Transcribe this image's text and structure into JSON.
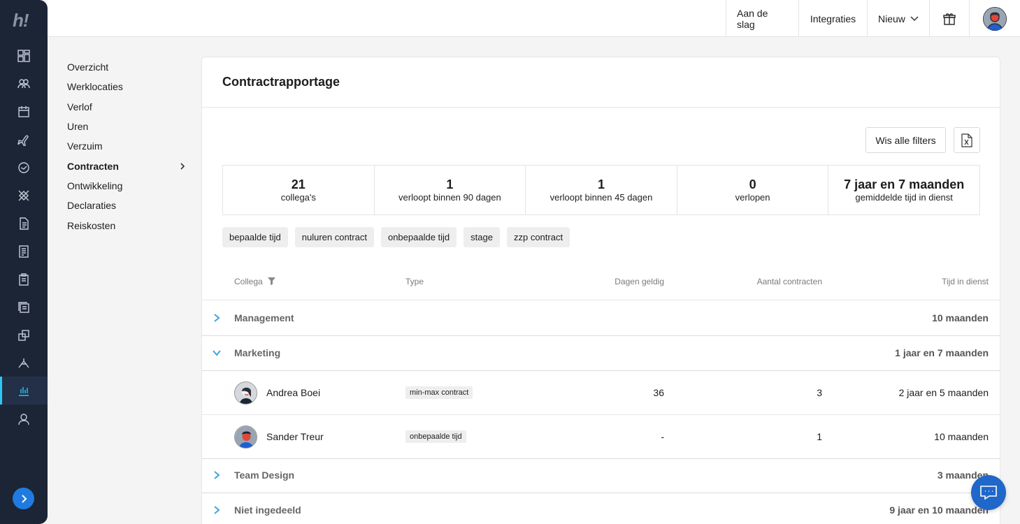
{
  "app": {
    "logo": "h!"
  },
  "topbar": {
    "getting_started": "Aan de slag",
    "integrations": "Integraties",
    "new": "Nieuw"
  },
  "submenu": [
    {
      "label": "Overzicht"
    },
    {
      "label": "Werklocaties"
    },
    {
      "label": "Verlof"
    },
    {
      "label": "Uren"
    },
    {
      "label": "Verzuim"
    },
    {
      "label": "Contracten",
      "active": true
    },
    {
      "label": "Ontwikkeling"
    },
    {
      "label": "Declaraties"
    },
    {
      "label": "Reiskosten"
    }
  ],
  "page": {
    "title": "Contractrapportage",
    "clear_filters": "Wis alle filters"
  },
  "stats": [
    {
      "value": "21",
      "label": "collega's"
    },
    {
      "value": "1",
      "label": "verloopt binnen 90 dagen"
    },
    {
      "value": "1",
      "label": "verloopt binnen 45 dagen"
    },
    {
      "value": "0",
      "label": "verlopen"
    },
    {
      "value": "7 jaar en 7 maanden",
      "label": "gemiddelde tijd in dienst"
    }
  ],
  "filters": [
    "bepaalde tijd",
    "nuluren contract",
    "onbepaalde tijd",
    "stage",
    "zzp contract"
  ],
  "table": {
    "columns": {
      "colleague": "Collega",
      "type": "Type",
      "days_valid": "Dagen geldig",
      "contract_count": "Aantal contracten",
      "time_in_service": "Tijd in dienst"
    },
    "groups": [
      {
        "name": "Management",
        "time": "10 maanden",
        "expanded": false
      },
      {
        "name": "Marketing",
        "time": "1 jaar en 7 maanden",
        "expanded": true,
        "rows": [
          {
            "name": "Andrea Boei",
            "type": "min-max contract",
            "days": "36",
            "count": "3",
            "time": "2 jaar en 5 maanden"
          },
          {
            "name": "Sander Treur",
            "type": "onbepaalde tijd",
            "days": "-",
            "count": "1",
            "time": "10 maanden"
          }
        ]
      },
      {
        "name": "Team Design",
        "time": "3 maanden",
        "expanded": false
      },
      {
        "name": "Niet ingedeeld",
        "time": "9 jaar en 10 maanden",
        "expanded": false
      }
    ]
  },
  "colors": {
    "rail": "#1c2536",
    "accent": "#2bc8f3",
    "chevron": "#3aa7d9",
    "chat": "#1f67c9"
  }
}
